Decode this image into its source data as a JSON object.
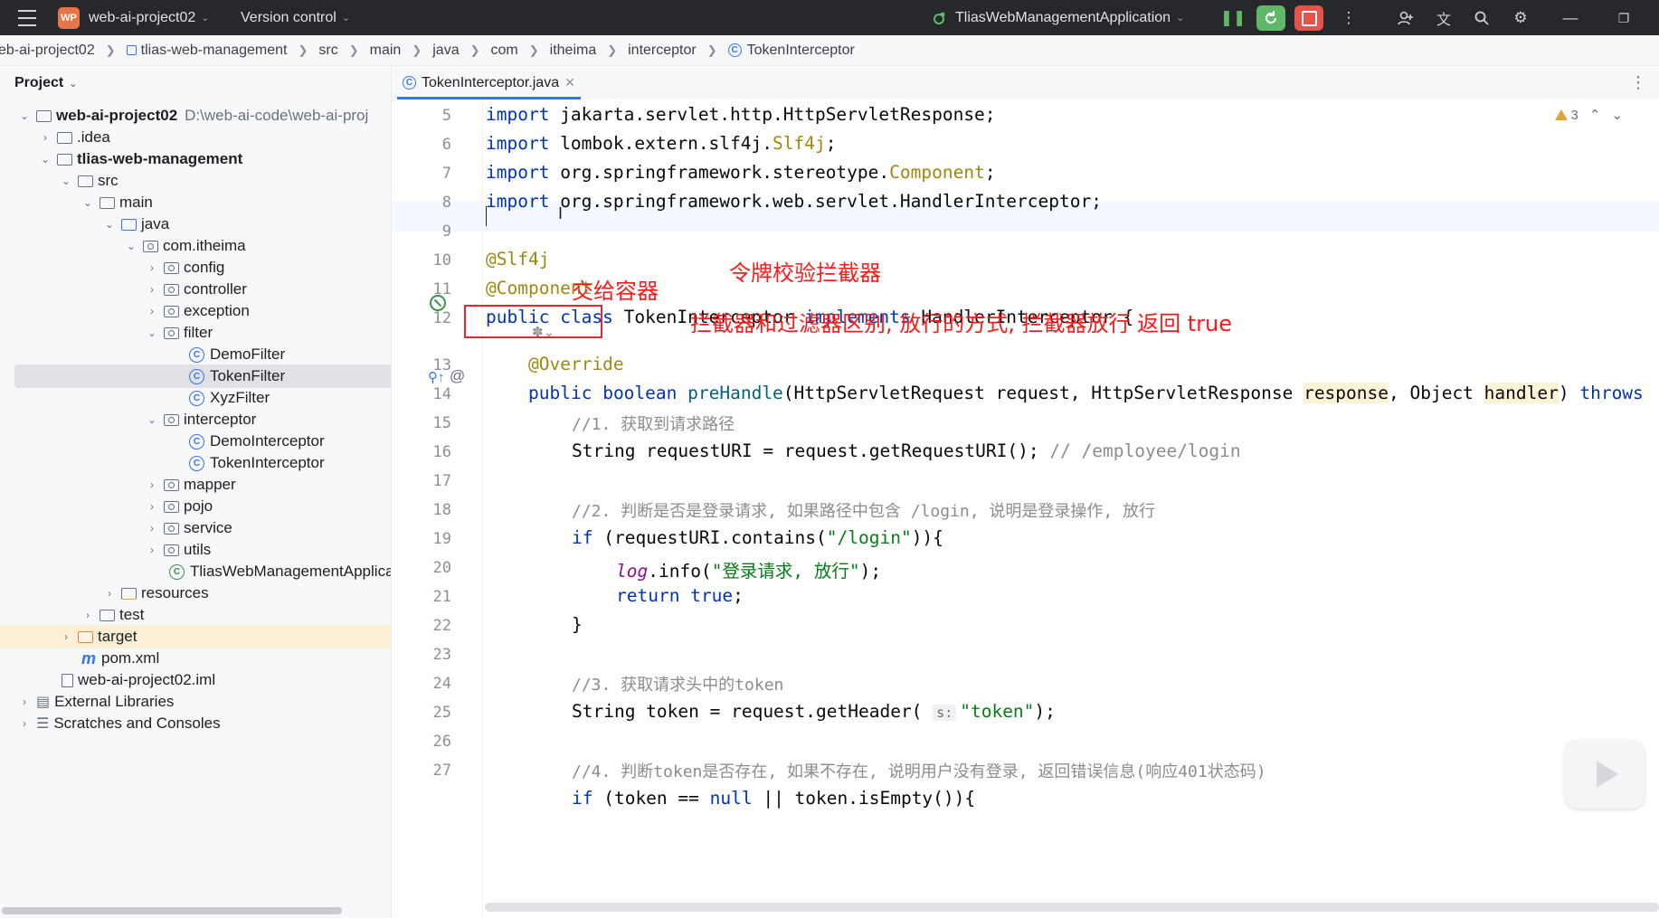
{
  "titlebar": {
    "project_badge": "WP",
    "project_name": "web-ai-project02",
    "version_control": "Version control",
    "run_config": "TliasWebManagementApplication"
  },
  "breadcrumb": [
    "eb-ai-project02",
    "tlias-web-management",
    "src",
    "main",
    "java",
    "com",
    "itheima",
    "interceptor",
    "TokenInterceptor"
  ],
  "project_panel": {
    "title": "Project",
    "tree": [
      {
        "label": "web-ai-project02",
        "path": "D:\\web-ai-code\\web-ai-proj",
        "bold": true
      },
      {
        "label": ".idea"
      },
      {
        "label": "tlias-web-management",
        "bold": true
      },
      {
        "label": "src"
      },
      {
        "label": "main"
      },
      {
        "label": "java"
      },
      {
        "label": "com.itheima"
      },
      {
        "label": "config"
      },
      {
        "label": "controller"
      },
      {
        "label": "exception"
      },
      {
        "label": "filter"
      },
      {
        "label": "DemoFilter"
      },
      {
        "label": "TokenFilter"
      },
      {
        "label": "XyzFilter"
      },
      {
        "label": "interceptor"
      },
      {
        "label": "DemoInterceptor"
      },
      {
        "label": "TokenInterceptor"
      },
      {
        "label": "mapper"
      },
      {
        "label": "pojo"
      },
      {
        "label": "service"
      },
      {
        "label": "utils"
      },
      {
        "label": "TliasWebManagementApplica"
      },
      {
        "label": "resources"
      },
      {
        "label": "test"
      },
      {
        "label": "target"
      },
      {
        "label": "pom.xml"
      },
      {
        "label": "web-ai-project02.iml"
      },
      {
        "label": "External Libraries"
      },
      {
        "label": "Scratches and Consoles"
      }
    ]
  },
  "editor": {
    "tab_label": "TokenInterceptor.java",
    "warnings_count": "3",
    "line_numbers": [
      "5",
      "6",
      "7",
      "8",
      "9",
      "10",
      "11",
      "12",
      "13",
      "14",
      "15",
      "16",
      "17",
      "18",
      "19",
      "20",
      "21",
      "22",
      "23",
      "24",
      "25",
      "26",
      "27"
    ],
    "code": {
      "l5_kw": "import",
      "l5_rest": " jakarta.servlet.http.HttpServletResponse;",
      "l6_kw": "import",
      "l6_mid": " lombok.extern.slf4j.",
      "l6_cls": "Slf4j",
      "l6_end": ";",
      "l7_kw": "import",
      "l7_mid": " org.springframework.stereotype.",
      "l7_cls": "Component",
      "l7_end": ";",
      "l8_kw": "import",
      "l8_rest": " org.springframework.web.servlet.HandlerInterceptor;",
      "l10": "@Slf4j",
      "l11": "@Component",
      "l12_kw1": "public",
      "l12_kw2": "class",
      "l12_name": " TokenInterceptor ",
      "l12_kw3": "implements",
      "l12_rest": " HandlerInterceptor {",
      "l13": "@Override",
      "l14_kw1": "public",
      "l14_kw2": "boolean",
      "l14_m": "preHandle",
      "l14_a": "(HttpServletRequest request, HttpServletResponse ",
      "l14_p1": "response",
      "l14_b": ", Object ",
      "l14_p2": "handler",
      "l14_c": ") ",
      "l14_kw3": "throws",
      "l15": "//1. 获取到请求路径",
      "l16_a": "String requestURI = request.getRequestURI(); ",
      "l16_cm": "// /employee/login",
      "l18": "//2. 判断是否是登录请求, 如果路径中包含 /login, 说明是登录操作, 放行",
      "l19_kw": "if",
      "l19_a": " (requestURI.contains(",
      "l19_s": "\"/login\"",
      "l19_b": ")){",
      "l20_log": "log",
      "l20_a": ".info(",
      "l20_s": "\"登录请求, 放行\"",
      "l20_b": ");",
      "l21_kw": "return",
      "l21_t": "true",
      "l21_e": ";",
      "l22": "}",
      "l24": "//3. 获取请求头中的token",
      "l25_a": "String token = request.getHeader( ",
      "l25_hint": "s:",
      "l25_s": "\"token\"",
      "l25_b": ");",
      "l27": "//4. 判断token是否存在, 如果不存在, 说明用户没有登录, 返回错误信息(响应401状态码)",
      "l28_kw": "if",
      "l28_a": " (token == ",
      "l28_n": "null",
      "l28_b": " || token.isEmpty()){"
    }
  },
  "annotations": {
    "interceptor_label": "令牌校验拦截器",
    "container_label": "交给容器",
    "difference_note": "拦截器和过滤器区别, 放行的方式, 拦截器放行 返回 true"
  },
  "colors": {
    "accent": "#3574f0",
    "annotation_red": "#ff1a1a",
    "title_bg": "#27282c"
  }
}
